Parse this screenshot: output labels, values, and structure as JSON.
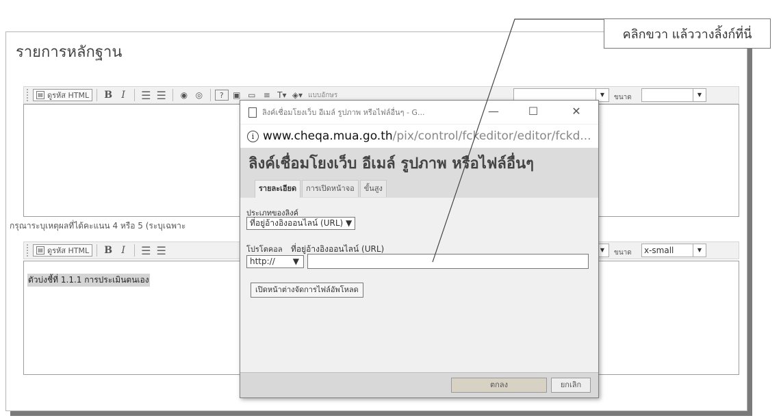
{
  "section_title": "รายการหลักฐาน",
  "callout_text": "คลิกขวา แล้ววางลิ้งก์ที่นี่",
  "toolbar": {
    "source_label": "ดูรหัส HTML",
    "bold_label": "B",
    "italic_label": "I",
    "font_label": "แบบอักษร",
    "size_label": "ขนาด",
    "toolbar2_size_value": "x-small"
  },
  "reason_label": "กรุณาระบุเหตุผลที่ได้คะแนน 4 หรือ 5 (ระบุเฉพาะ",
  "editor2_content": "ตัวบ่งชี้ที่ 1.1.1 การประเมินตนเอง",
  "dialog": {
    "window_title": "ลิงค์เชื่อมโยงเว็บ อีเมล์ รูปภาพ หรือไฟล์อื่นๆ - G...",
    "url_host": "www.cheqa.mua.go.th",
    "url_path": "/pix/control/fckeditor/editor/fckd...",
    "header_title": "ลิงค์เชื่อมโยงเว็บ อีเมล์ รูปภาพ หรือไฟล์อื่นๆ",
    "tabs": [
      {
        "label": "รายละเอียด",
        "active": true
      },
      {
        "label": "การเปิดหน้าจอ",
        "active": false
      },
      {
        "label": "ขั้นสูง",
        "active": false
      }
    ],
    "link_type_label": "ประเภทของลิงค์",
    "link_type_value": "ที่อยู่อ้างอิงออนไลน์ (URL)",
    "protocol_label": "โปรโตคอล",
    "protocol_value": "http://",
    "url_label": "ที่อยู่อ้างอิงออนไลน์ (URL)",
    "url_value": "",
    "browse_button": "เปิดหน้าต่างจัดการไฟล์อัพโหลด",
    "ok_button": "ตกลง",
    "cancel_button": "ยกเลิก"
  }
}
